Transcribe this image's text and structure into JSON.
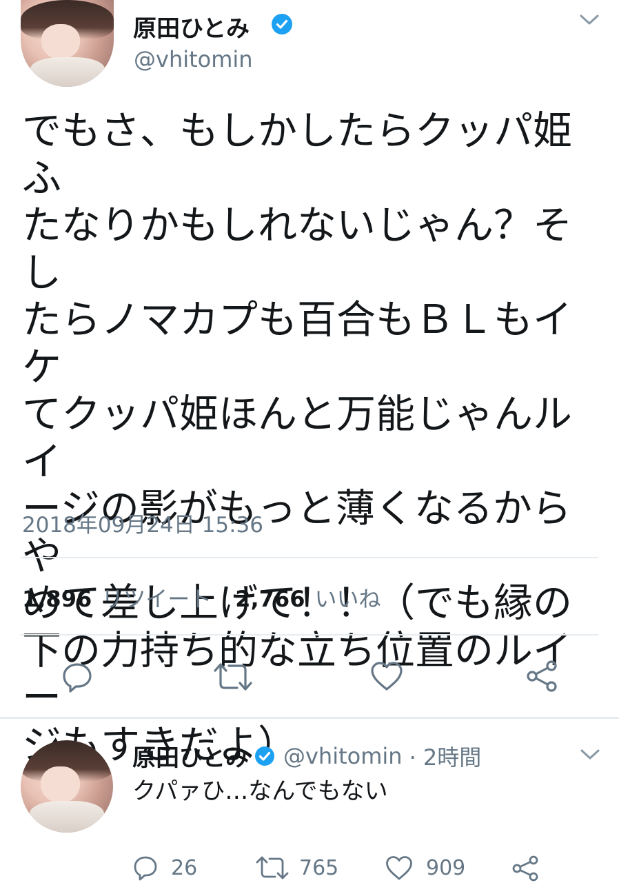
{
  "main_tweet": {
    "author_name": "原田ひとみ",
    "author_handle": "@vhitomin",
    "text_lines": [
      "でもさ、もしかしたらクッパ姫ふ",
      "たなりかもしれないじゃん？そし",
      "たらノマカプも百合もＢＬもイケ",
      "てクッパ姫ほんと万能じゃんルイ",
      "ージの影がもっと薄くなるからや",
      "めて差し上げて！！（でも縁の",
      "下の力持ち的な立ち位置のルイー",
      "ジもすきだよ）"
    ],
    "timestamp": "2018年09月24日 15:36",
    "retweet_count": "1,896",
    "retweet_label": "リツイート",
    "like_count": "2,766",
    "like_label": "いいね",
    "actions": [
      "reply-icon",
      "retweet-icon",
      "like-icon",
      "share-icon"
    ]
  },
  "reply_tweet": {
    "author_name": "原田ひとみ",
    "author_handle": "@vhitomin",
    "time": "· 2時間",
    "text": "クパァひ…なんでもない",
    "reply_count": "26",
    "retweet_count": "765",
    "like_count": "909"
  },
  "colors": {
    "verified": "#1da1f2",
    "secondary_text": "#657786",
    "divider": "#e6ecf0",
    "primary_text": "#14171a"
  }
}
